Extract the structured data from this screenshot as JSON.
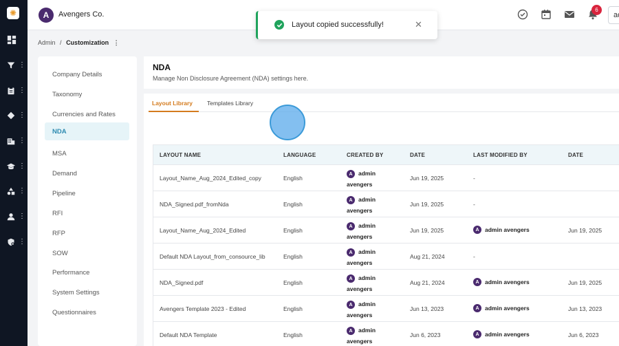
{
  "app": {
    "brand": "Avengers Co.",
    "brand_initial": "A",
    "user_initials": "ad",
    "notification_count": "6"
  },
  "breadcrumb": {
    "root": "Admin",
    "separator": "/",
    "current": "Customization",
    "menu": "⋮"
  },
  "rail": {
    "items": [
      {
        "icon": "dashboard-icon"
      },
      {
        "icon": "filter-icon"
      },
      {
        "icon": "clipboard-icon"
      },
      {
        "icon": "tag-icon"
      },
      {
        "icon": "building-icon"
      },
      {
        "icon": "graduation-cap-icon"
      },
      {
        "icon": "shapes-icon"
      },
      {
        "icon": "user-icon"
      },
      {
        "icon": "shield-gear-icon"
      }
    ]
  },
  "subnav": {
    "items": [
      {
        "label": "Company Details"
      },
      {
        "label": "Taxonomy"
      },
      {
        "label": "Currencies and Rates"
      },
      {
        "label": "NDA"
      },
      {
        "label": "MSA"
      },
      {
        "label": "Demand"
      },
      {
        "label": "Pipeline"
      },
      {
        "label": "RFI"
      },
      {
        "label": "RFP"
      },
      {
        "label": "SOW"
      },
      {
        "label": "Performance"
      },
      {
        "label": "System Settings"
      },
      {
        "label": "Questionnaires"
      }
    ],
    "active_index": 3
  },
  "page": {
    "title": "NDA",
    "subtitle": "Manage Non Disclosure Agreement (NDA) settings here."
  },
  "tabs": [
    {
      "label": "Layout Library"
    },
    {
      "label": "Templates Library"
    }
  ],
  "table": {
    "headers": [
      "LAYOUT NAME",
      "LANGUAGE",
      "CREATED BY",
      "DATE",
      "LAST MODIFIED BY",
      "DATE"
    ],
    "rows": [
      {
        "name": "Layout_Name_Aug_2024_Edited_copy",
        "language": "English",
        "created_first": "admin",
        "created_last": "avengers",
        "date": "Jun 19, 2025",
        "modified_by": "-",
        "modified_date": ""
      },
      {
        "name": "NDA_Signed.pdf_fromNda",
        "language": "English",
        "created_first": "admin",
        "created_last": "avengers",
        "date": "Jun 19, 2025",
        "modified_by": "-",
        "modified_date": ""
      },
      {
        "name": "Layout_Name_Aug_2024_Edited",
        "language": "English",
        "created_first": "admin",
        "created_last": "avengers",
        "date": "Jun 19, 2025",
        "modified_by": "admin avengers",
        "modified_date": "Jun 19, 2025"
      },
      {
        "name": "Default NDA Layout_from_consource_lib",
        "language": "English",
        "created_first": "admin",
        "created_last": "avengers",
        "date": "Aug 21, 2024",
        "modified_by": "-",
        "modified_date": ""
      },
      {
        "name": "NDA_Signed.pdf",
        "language": "English",
        "created_first": "admin",
        "created_last": "avengers",
        "date": "Aug 21, 2024",
        "modified_by": "admin avengers",
        "modified_date": "Jun 19, 2025"
      },
      {
        "name": "Avengers Template 2023 - Edited",
        "language": "English",
        "created_first": "admin",
        "created_last": "avengers",
        "date": "Jun 13, 2023",
        "modified_by": "admin avengers",
        "modified_date": "Jun 13, 2023"
      },
      {
        "name": "Default NDA Template",
        "language": "English",
        "created_first": "admin",
        "created_last": "avengers",
        "date": "Jun 6, 2023",
        "modified_by": "admin avengers",
        "modified_date": "Jun 6, 2023"
      }
    ]
  },
  "toast": {
    "message": "Layout copied successfully!",
    "close": "✕"
  },
  "colors": {
    "accent": "#d47b1e",
    "active_nav": "#2d8ab0",
    "success": "#1fa35c",
    "badge": "#d9243d",
    "rail_bg": "#0f1623"
  }
}
